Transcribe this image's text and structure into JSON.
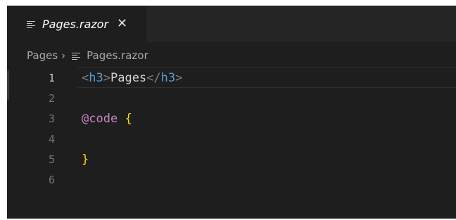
{
  "tab": {
    "icon": "file-lines-icon",
    "label": "Pages.razor",
    "close": "✕"
  },
  "breadcrumb": {
    "folder": "Pages",
    "separator": "›",
    "file_icon": "file-lines-icon",
    "file": "Pages.razor"
  },
  "editor": {
    "active_line": 1,
    "lines": [
      {
        "number": "1",
        "tokens": {
          "lt": "<",
          "open_tag": "h3",
          "gt": ">",
          "text": "Pages",
          "close_lt": "</",
          "close_tag": "h3",
          "close_gt": ">"
        }
      },
      {
        "number": "2"
      },
      {
        "number": "3",
        "tokens": {
          "directive": "@code",
          "space": " ",
          "brace": "{"
        }
      },
      {
        "number": "4"
      },
      {
        "number": "5",
        "tokens": {
          "brace": "}"
        }
      },
      {
        "number": "6"
      }
    ]
  },
  "colors": {
    "editor_bg": "#1e1e1e",
    "tag_name": "#569cd6",
    "directive": "#c586c0",
    "brace": "#ffd700"
  }
}
